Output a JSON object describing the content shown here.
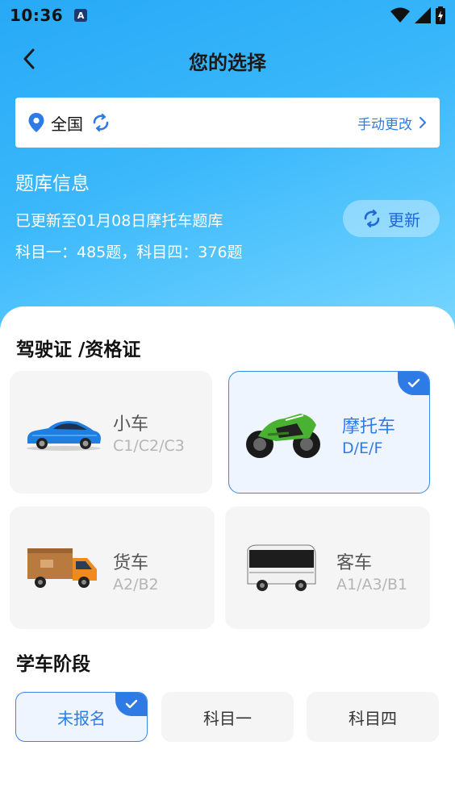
{
  "status_bar": {
    "time": "10:36",
    "notification_letter": "A"
  },
  "header": {
    "title": "您的选择"
  },
  "region": {
    "name": "全国",
    "change_label": "手动更改"
  },
  "question_bank": {
    "title": "题库信息",
    "updated_text": "已更新至01月08日摩托车题库",
    "counts_text": "科目一：485题，科目四：376题",
    "update_button": "更新"
  },
  "license_section": {
    "title": "驾驶证 /资格证",
    "vehicles": [
      {
        "name": "小车",
        "classes": "C1/C2/C3",
        "selected": false,
        "icon": "car-icon"
      },
      {
        "name": "摩托车",
        "classes": "D/E/F",
        "selected": true,
        "icon": "motorcycle-icon"
      },
      {
        "name": "货车",
        "classes": "A2/B2",
        "selected": false,
        "icon": "truck-icon"
      },
      {
        "name": "客车",
        "classes": "A1/A3/B1",
        "selected": false,
        "icon": "bus-icon"
      }
    ]
  },
  "stage_section": {
    "title": "学车阶段",
    "stages": [
      {
        "label": "未报名",
        "selected": true
      },
      {
        "label": "科目一",
        "selected": false
      },
      {
        "label": "科目四",
        "selected": false
      }
    ]
  },
  "colors": {
    "accent": "#2f7be6",
    "hero_start": "#27a9f6",
    "hero_end": "#7ad8ff"
  }
}
